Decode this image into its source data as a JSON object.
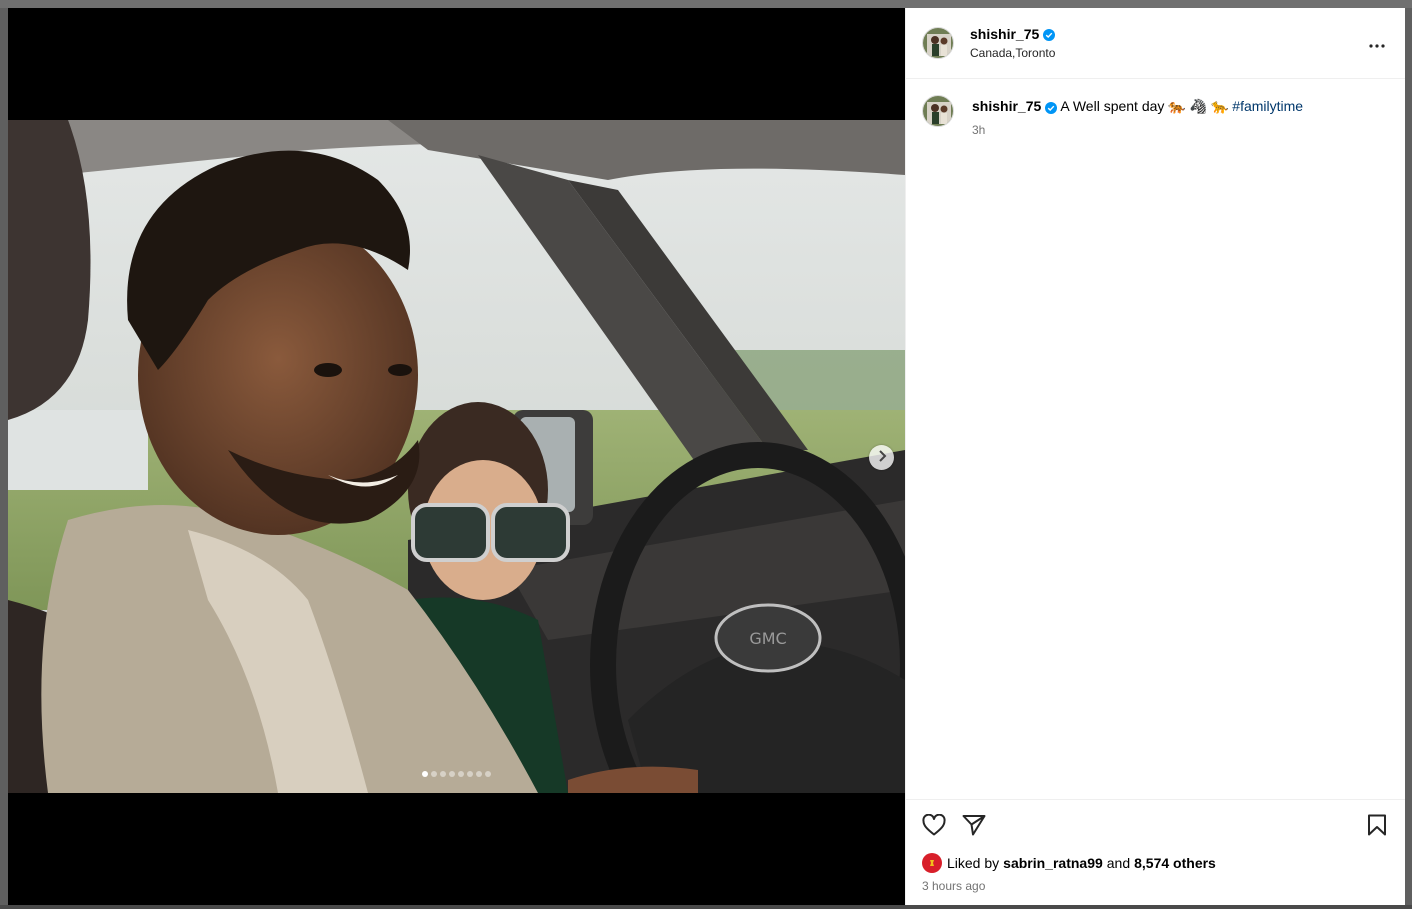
{
  "post": {
    "username": "shishir_75",
    "location": "Canada,Toronto",
    "caption": {
      "username": "shishir_75",
      "text": "A Well spent day 🐅 🦓 🐆",
      "hashtag": "#familytime",
      "age": "3h"
    },
    "carousel": {
      "total_slides": 8,
      "active_slide": 1
    },
    "likes": {
      "prefix": "Liked by",
      "liker": "sabrin_ratna99",
      "conj": "and",
      "others": "8,574 others"
    },
    "posted_ago": "3 hours ago"
  },
  "icons": {
    "verified": "verified-badge-icon",
    "more": "more-options-icon",
    "like": "heart-icon",
    "share": "paper-plane-icon",
    "save": "bookmark-icon",
    "next": "chevron-right-icon"
  },
  "colors": {
    "verified": "#0095f6",
    "hashtag": "#00376b",
    "muted": "#737373",
    "liker_avatar": "#d81f2a"
  }
}
